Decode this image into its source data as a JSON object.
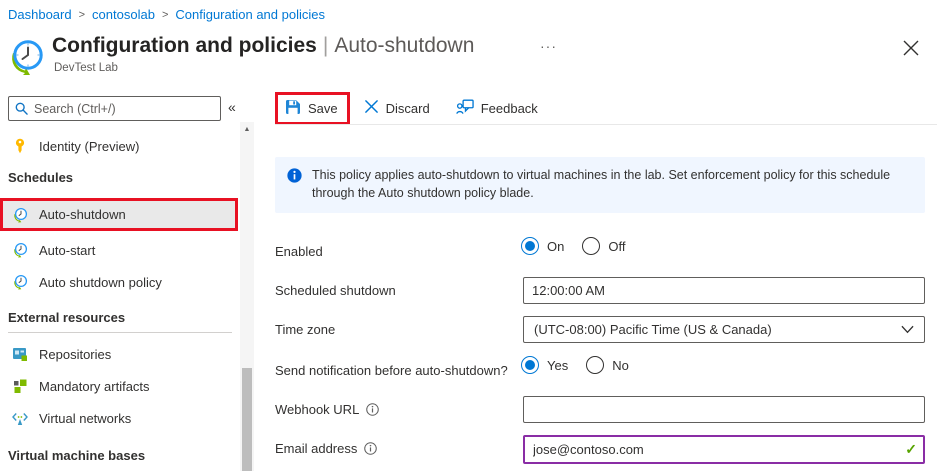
{
  "breadcrumb": {
    "separator": ">",
    "items": [
      "Dashboard",
      "contosolab",
      "Configuration and policies"
    ]
  },
  "header": {
    "title": "Configuration and policies",
    "separator": "|",
    "active_blade": "Auto-shutdown",
    "resource_type": "DevTest Lab",
    "more_glyph": "···"
  },
  "toolbar": {
    "save_label": "Save",
    "discard_label": "Discard",
    "feedback_label": "Feedback"
  },
  "sidebar": {
    "search_placeholder": "Search (Ctrl+/)",
    "collapse_glyph": "«",
    "scroll_up_glyph": "▲",
    "sections": {
      "schedules": "Schedules",
      "external_resources": "External resources",
      "virtual_machine_bases": "Virtual machine bases"
    },
    "items": {
      "identity": "Identity (Preview)",
      "auto_shutdown": "Auto-shutdown",
      "auto_start": "Auto-start",
      "auto_shutdown_policy": "Auto shutdown policy",
      "repositories": "Repositories",
      "mandatory_artifacts": "Mandatory artifacts",
      "virtual_networks": "Virtual networks"
    }
  },
  "banner": {
    "text": "This policy applies auto-shutdown to virtual machines in the lab. Set enforcement policy for this schedule through the Auto shutdown policy blade."
  },
  "form": {
    "enabled": {
      "label": "Enabled",
      "options": [
        "On",
        "Off"
      ],
      "selected": "On"
    },
    "scheduled_shutdown": {
      "label": "Scheduled shutdown",
      "value": "12:00:00 AM"
    },
    "time_zone": {
      "label": "Time zone",
      "value": "(UTC-08:00) Pacific Time (US & Canada)"
    },
    "send_notification": {
      "label": "Send notification before auto-shutdown?",
      "options": [
        "Yes",
        "No"
      ],
      "selected": "Yes"
    },
    "webhook_url": {
      "label": "Webhook URL",
      "value": ""
    },
    "email_address": {
      "label": "Email address",
      "value": "jose@contoso.com",
      "valid_glyph": "✓"
    }
  },
  "colors": {
    "accent_blue": "#0078d4",
    "highlight_red": "#e81123",
    "banner_bg": "#f0f6ff",
    "valid_green": "#57a300",
    "email_border_purple": "#8a2da5",
    "selected_item_bg": "#e9e9e9"
  }
}
